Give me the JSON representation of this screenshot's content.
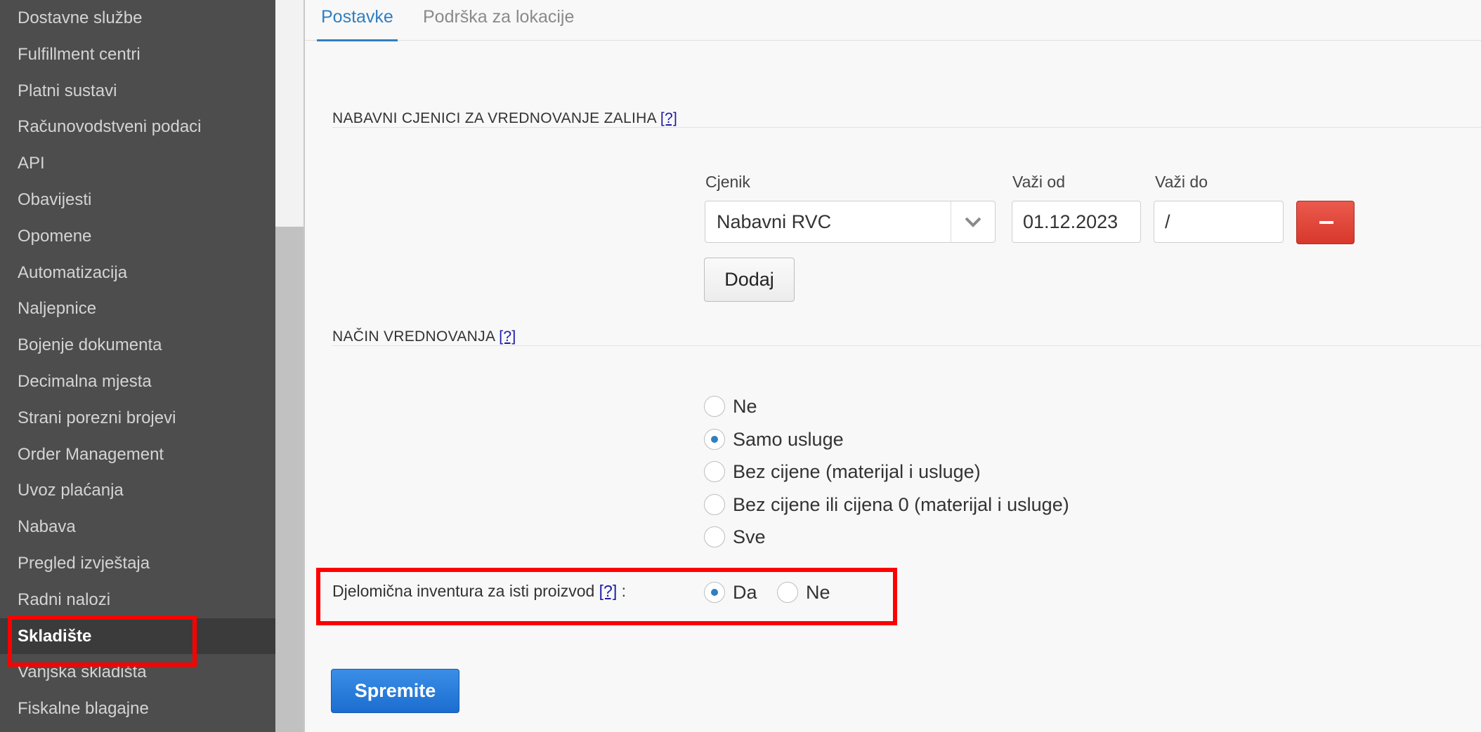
{
  "sidebar": {
    "items": [
      {
        "label": "Dostavne službe"
      },
      {
        "label": "Fulfillment centri"
      },
      {
        "label": "Platni sustavi"
      },
      {
        "label": "Računovodstveni podaci"
      },
      {
        "label": "API"
      },
      {
        "label": "Obavijesti"
      },
      {
        "label": "Opomene"
      },
      {
        "label": "Automatizacija"
      },
      {
        "label": "Naljepnice"
      },
      {
        "label": "Bojenje dokumenta"
      },
      {
        "label": "Decimalna mjesta"
      },
      {
        "label": "Strani porezni brojevi"
      },
      {
        "label": "Order Management"
      },
      {
        "label": "Uvoz plaćanja"
      },
      {
        "label": "Nabava"
      },
      {
        "label": "Pregled izvještaja"
      },
      {
        "label": "Radni nalozi"
      },
      {
        "label": "Skladište"
      },
      {
        "label": "Vanjska skladišta"
      },
      {
        "label": "Fiskalne blagajne"
      }
    ],
    "active_label": "Skladište"
  },
  "tabs": [
    {
      "label": "Postavke",
      "active": true
    },
    {
      "label": "Podrška za lokacije",
      "active": false
    }
  ],
  "pricelists_section": {
    "title": "NABAVNI CJENICI ZA VREDNOVANJE ZALIHA",
    "help": "[?]",
    "columns": {
      "pricelist": "Cjenik",
      "valid_from": "Važi od",
      "valid_to": "Važi do"
    },
    "row": {
      "pricelist": "Nabavni RVC",
      "valid_from": "01.12.2023",
      "valid_to": "/"
    },
    "add_button": "Dodaj"
  },
  "valuation_section": {
    "title": "NAČIN VREDNOVANJA",
    "help": "[?]",
    "options": [
      {
        "label": "Ne",
        "checked": false
      },
      {
        "label": "Samo usluge",
        "checked": true
      },
      {
        "label": "Bez cijene (materijal i usluge)",
        "checked": false
      },
      {
        "label": "Bez cijene ili cijena 0 (materijal i usluge)",
        "checked": false
      },
      {
        "label": "Sve",
        "checked": false
      }
    ]
  },
  "partial_inventory": {
    "label": "Djelomična inventura za isti proizvod",
    "help": "[?]",
    "suffix": " :",
    "options": [
      {
        "label": "Da",
        "checked": true
      },
      {
        "label": "Ne",
        "checked": false
      }
    ]
  },
  "save_button": "Spremite",
  "colors": {
    "sidebar_bg": "#4d4d4d",
    "accent": "#2f7fc1",
    "highlight": "#ff0000",
    "danger": "#d8382b"
  }
}
